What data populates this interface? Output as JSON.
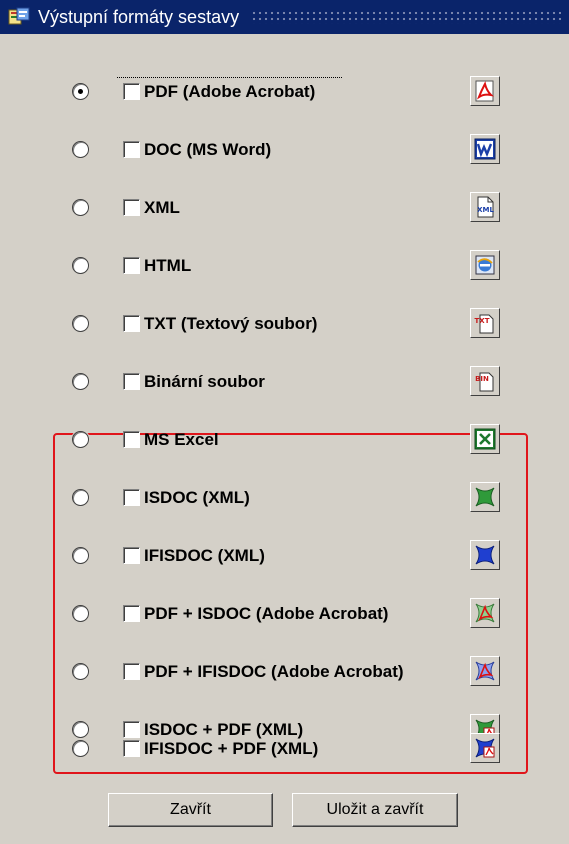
{
  "window": {
    "title": "Výstupní formáty sestavy"
  },
  "formats": [
    {
      "label": "PDF (Adobe Acrobat)",
      "icon": "pdf-icon",
      "selected": true
    },
    {
      "label": "DOC (MS Word)",
      "icon": "word-icon",
      "selected": false
    },
    {
      "label": "XML",
      "icon": "xml-icon",
      "selected": false
    },
    {
      "label": "HTML",
      "icon": "html-icon",
      "selected": false
    },
    {
      "label": "TXT (Textový soubor)",
      "icon": "txt-icon",
      "selected": false
    },
    {
      "label": "Binární soubor",
      "icon": "bin-icon",
      "selected": false
    },
    {
      "label": "MS Excel",
      "icon": "excel-icon",
      "selected": false
    },
    {
      "label": "ISDOC (XML)",
      "icon": "isdoc-icon",
      "selected": false
    },
    {
      "label": "IFISDOC (XML)",
      "icon": "ifisdoc-icon",
      "selected": false
    },
    {
      "label": "PDF + ISDOC (Adobe Acrobat)",
      "icon": "pdf-isdoc-icon",
      "selected": false
    },
    {
      "label": "PDF + IFISDOC (Adobe Acrobat)",
      "icon": "pdf-ifisdoc-icon",
      "selected": false
    },
    {
      "label": "ISDOC + PDF (XML)",
      "icon": "isdoc-pdf-icon",
      "selected": false
    },
    {
      "label": "IFISDOC + PDF (XML)",
      "icon": "ifisdoc-pdf-icon",
      "selected": false
    }
  ],
  "buttons": {
    "close": "Zavřít",
    "save_close": "Uložit a zavřít"
  },
  "colors": {
    "dialog_bg": "#d4d0c8",
    "titlebar": "#0a246a",
    "highlight": "#e0151b"
  }
}
